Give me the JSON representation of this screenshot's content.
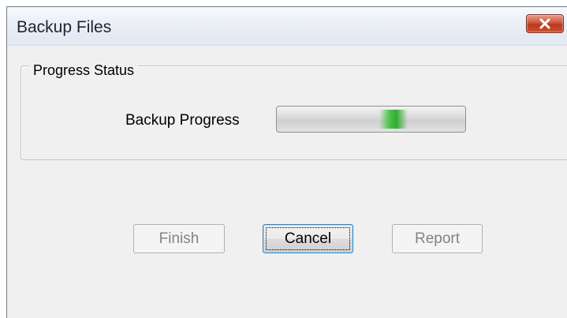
{
  "window": {
    "title": "Backup Files",
    "close_icon": "close-x-icon",
    "close_color": "#c8442b"
  },
  "group": {
    "legend": "Progress Status"
  },
  "progress": {
    "label": "Backup Progress",
    "style": "marquee",
    "color": "#2db52d"
  },
  "buttons": {
    "finish": {
      "label": "Finish",
      "enabled": false
    },
    "cancel": {
      "label": "Cancel",
      "enabled": true,
      "default": true
    },
    "report": {
      "label": "Report",
      "enabled": false
    }
  }
}
